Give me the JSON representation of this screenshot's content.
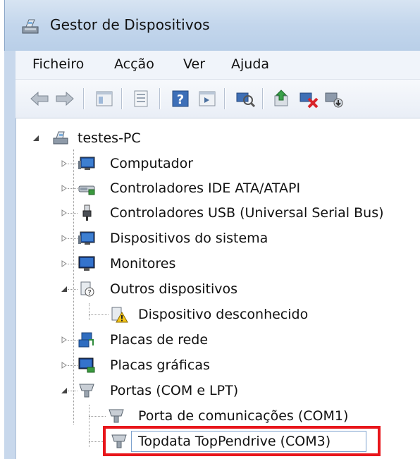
{
  "window": {
    "title": "Gestor de Dispositivos"
  },
  "menu": {
    "items": [
      "Ficheiro",
      "Acção",
      "Ver",
      "Ajuda"
    ]
  },
  "toolbar": {
    "buttons": [
      "back-icon",
      "forward-icon",
      "properties-panel-icon",
      "properties-icon",
      "help-icon",
      "action-pane-icon",
      "scan-hardware-icon",
      "update-driver-icon",
      "disable-device-icon",
      "uninstall-device-icon"
    ]
  },
  "tree": {
    "root": "testes-PC",
    "items": [
      "Computador",
      "Controladores IDE ATA/ATAPI",
      "Controladores USB (Universal Serial Bus)",
      "Dispositivos do sistema",
      "Monitores",
      "Outros dispositivos",
      "Dispositivo desconhecido",
      "Placas de rede",
      "Placas gráficas",
      "Portas (COM e LPT)",
      "Porta de comunicações (COM1)",
      "Topdata TopPendrive (COM3)"
    ]
  },
  "colors": {
    "highlight": "#e8161b",
    "titlebar": "#c3d6ec"
  }
}
